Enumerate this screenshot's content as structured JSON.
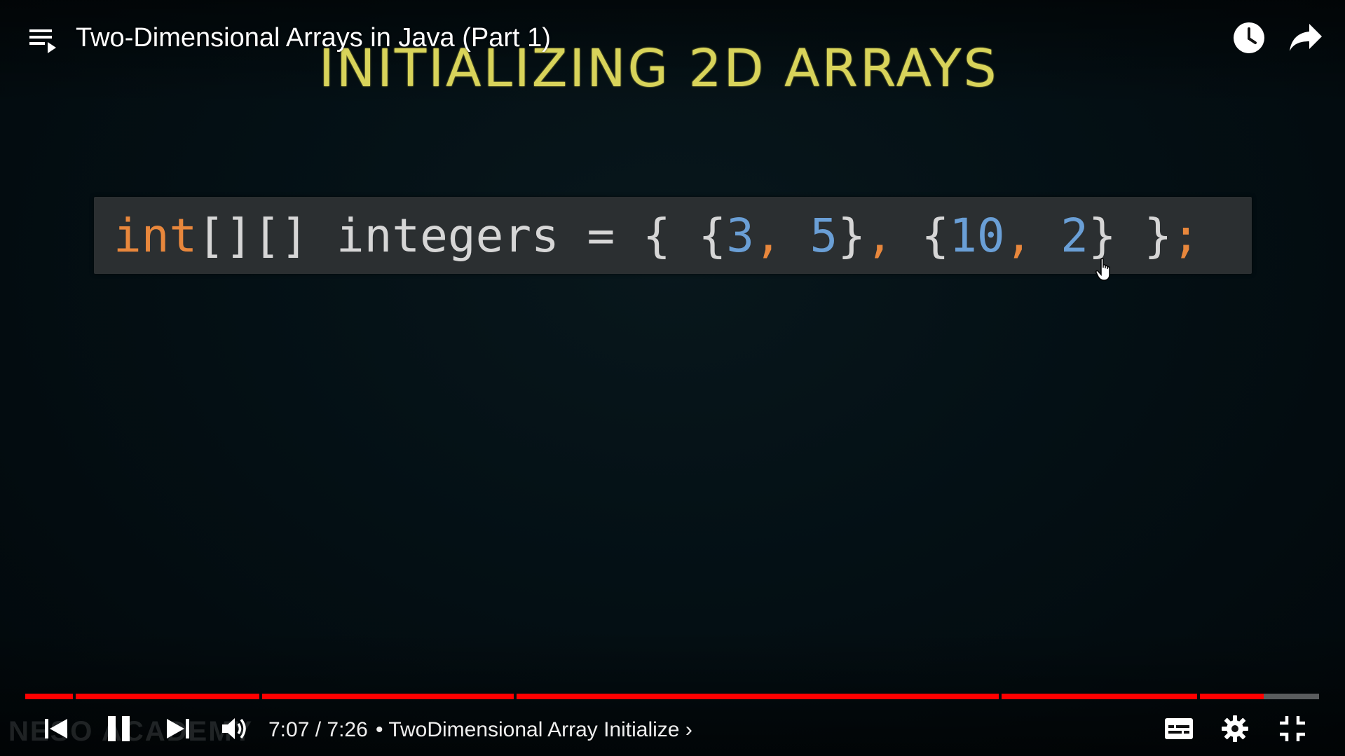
{
  "player": {
    "title": "Two-Dimensional Arrays in Java (Part 1)",
    "current_time": "7:07",
    "duration": "7:26",
    "time_separator": " / ",
    "chapter_bullet": "•",
    "chapter": "TwoDimensional Array Initialize",
    "chapter_arrow": "›",
    "progress_fraction": 0.9573,
    "watermark": "NESO ACADEMY"
  },
  "slide": {
    "heading": "INITIALIZING 2D ARRAYS",
    "code": {
      "kw": "int",
      "brackets": "[][]",
      "name": " integers = { {",
      "n1": "3",
      "c1": ",",
      "sp1": " ",
      "n2": "5",
      "cl1": "}",
      "c2": ",",
      "op2": " {",
      "n3": "10",
      "c3": ",",
      "sp3": " ",
      "n4": "2",
      "cl2": "} }",
      "semi": ";"
    }
  },
  "colors": {
    "progress_played": "#ff0000",
    "heading": "#d8d35a",
    "keyword": "#e8873c",
    "number": "#6a9fd6"
  },
  "icons": {
    "playlist": "playlist-icon",
    "watch_later": "clock-icon",
    "share": "share-icon",
    "previous": "skip-previous-icon",
    "pause": "pause-icon",
    "next": "skip-next-icon",
    "volume": "volume-icon",
    "subtitles": "subtitles-icon",
    "settings": "gear-icon",
    "exit_fullscreen": "exit-fullscreen-icon"
  }
}
